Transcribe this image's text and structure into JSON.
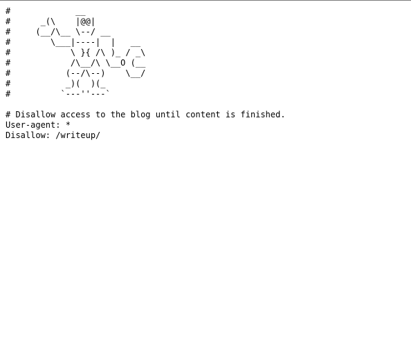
{
  "document": {
    "lines": [
      "#             __",
      "#      _(\\    |@@|",
      "#     (__/\\__ \\--/ __",
      "#        \\___|----|  |   __",
      "#            \\ }{ /\\ )_ / _\\",
      "#            /\\__/\\ \\__O (__",
      "#           (--/\\--)    \\__/",
      "#           _)(  )(_",
      "#          `---''---`",
      "",
      "# Disallow access to the blog until content is finished.",
      "User-agent: *",
      "Disallow: /writeup/"
    ]
  }
}
